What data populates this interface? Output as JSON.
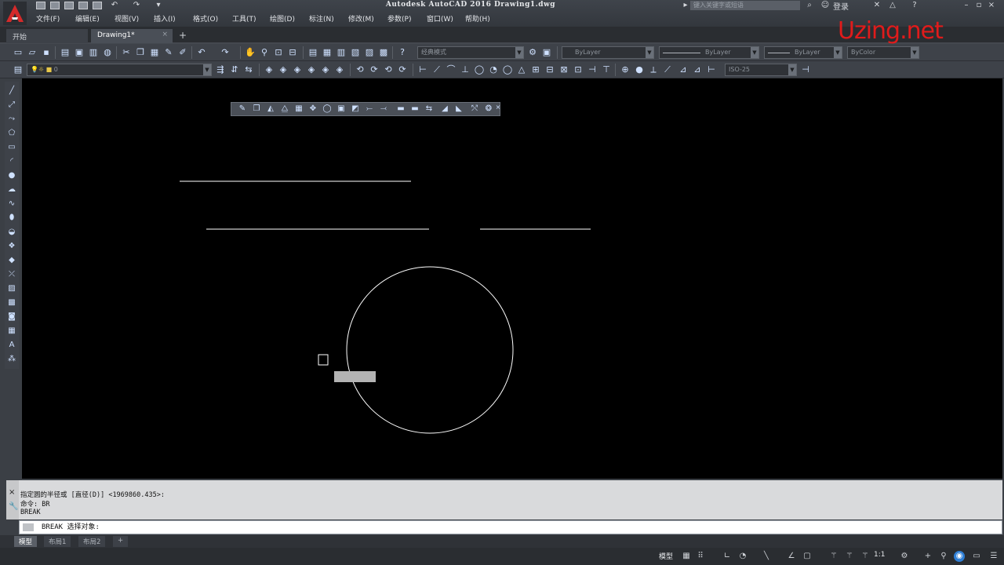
{
  "window": {
    "title": "Autodesk AutoCAD 2016    Drawing1.dwg",
    "search_placeholder": "键入关键字或短语",
    "login": "登录"
  },
  "menu": [
    "文件(F)",
    "编辑(E)",
    "视图(V)",
    "插入(I)",
    "格式(O)",
    "工具(T)",
    "绘图(D)",
    "标注(N)",
    "修改(M)",
    "参数(P)",
    "窗口(W)",
    "帮助(H)"
  ],
  "tabs": {
    "start": "开始",
    "drawing": "Drawing1*",
    "close": "×",
    "add": "+"
  },
  "toolbar": {
    "workspace": "经典模式",
    "color": "ByLayer",
    "linetype": "ByLayer",
    "lineweight": "ByLayer",
    "plotstyle": "ByColor",
    "layer": "0",
    "dimstyle": "ISO-25"
  },
  "watermark": "Uzing.net",
  "command": {
    "history": [
      "指定圆的半径或 [直径(D)] <1969860.435>:",
      "命令: BR",
      "BREAK"
    ],
    "prompt": "BREAK 选择对象:"
  },
  "layout_tabs": [
    "模型",
    "布局1",
    "布局2",
    "+"
  ],
  "status": {
    "model": "模型",
    "scale": "1:1"
  },
  "colors": {
    "canvas": "#000000",
    "accent": "#e01b1b",
    "ui_dark": "#3e4249"
  },
  "icons": {
    "logo": "autocad-logo",
    "cmd_close": "close-icon",
    "cmd_settings": "wrench-icon"
  }
}
